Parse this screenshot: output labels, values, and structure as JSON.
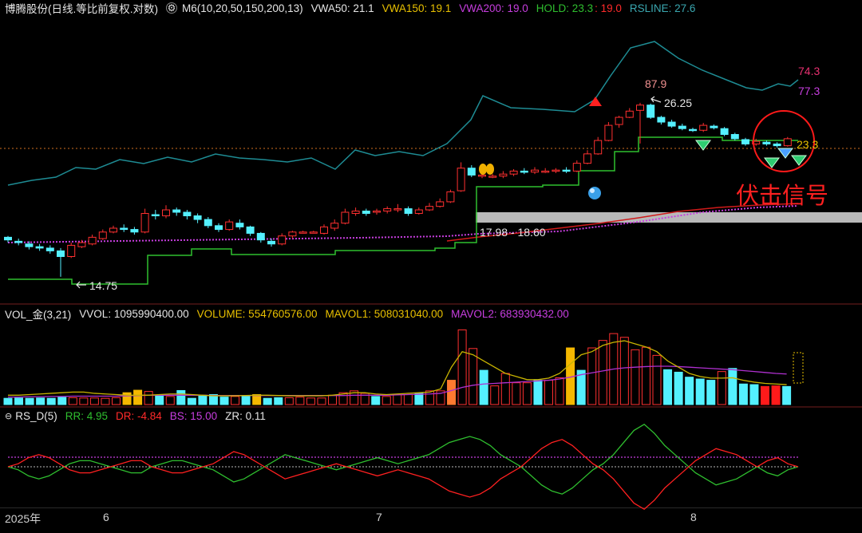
{
  "main_header": {
    "title": "博腾股份(日线.等比前复权.对数)",
    "m6": "M6(10,20,50,150,200,13)",
    "vwa50": "VWA50: 21.1",
    "vwa150": "VWA150: 19.1",
    "vwa200": "VWA200: 19.0",
    "hold": "HOLD: 23.3",
    "hold_red": ": 19.0",
    "rsline": "RSLINE: 27.6"
  },
  "vol_header": {
    "name": "VOL_金(3,21)",
    "vvol": "VVOL: 1095990400.00",
    "volume": "VOLUME: 554760576.00",
    "mavol1": "MAVOL1: 508031040.00",
    "mavol2": "MAVOL2: 683930432.00"
  },
  "rs_header": {
    "name": "RS_D(5)",
    "rr": "RR: 4.95",
    "dr": "DR: -4.84",
    "bs": "BS: 15.00",
    "zr": "ZR: 0.11"
  },
  "annotations": {
    "low_label": "14.75",
    "high_label": "26.25",
    "range_label": "17.98 - 18.60",
    "rs_peak": "87.9",
    "rs_right_1": "74.3",
    "rs_right_2": "77.3",
    "price_tag": "23.3",
    "signal_text": "伏击信号"
  },
  "x_axis": {
    "labels": [
      "2025年",
      "6",
      "7",
      "8"
    ]
  },
  "colors": {
    "up": "#ff3030",
    "down": "#54f0ff",
    "hold": "#2fbf2f",
    "rsline": "#1e8c94",
    "vwa": "#c83ee0",
    "ma_red": "#d01a1a",
    "mavol1": "#c8b400",
    "mavol2": "#b030d0",
    "highlight_bar": "#f5b800"
  },
  "chart_data": [
    {
      "type": "candlestick",
      "title": "博腾股份(日线.等比前复权.对数)",
      "candles": [
        [
          17.5,
          17.3,
          17.6,
          17.1
        ],
        [
          17.2,
          17.1,
          17.4,
          16.9
        ],
        [
          17.0,
          16.8,
          17.2,
          16.6
        ],
        [
          16.8,
          16.7,
          17.0,
          16.5
        ],
        [
          16.7,
          16.5,
          16.9,
          16.3
        ],
        [
          16.5,
          16.1,
          16.7,
          14.75
        ],
        [
          16.1,
          16.9,
          17.1,
          16.0
        ],
        [
          16.8,
          17.1,
          17.3,
          16.7
        ],
        [
          17.0,
          17.5,
          17.7,
          16.9
        ],
        [
          17.4,
          17.9,
          18.1,
          17.3
        ],
        [
          17.9,
          18.2,
          18.4,
          17.8
        ],
        [
          18.2,
          18.1,
          18.5,
          17.9
        ],
        [
          18.1,
          17.9,
          18.3,
          17.7
        ],
        [
          17.9,
          19.4,
          19.8,
          17.8
        ],
        [
          19.3,
          19.2,
          19.7,
          18.9
        ],
        [
          19.2,
          19.7,
          20.1,
          19.0
        ],
        [
          19.7,
          19.5,
          19.9,
          19.2
        ],
        [
          19.5,
          19.2,
          19.7,
          18.9
        ],
        [
          19.2,
          18.9,
          19.4,
          18.6
        ],
        [
          18.9,
          18.4,
          19.1,
          18.2
        ],
        [
          18.4,
          18.1,
          18.6,
          17.9
        ],
        [
          18.1,
          18.7,
          18.9,
          18.0
        ],
        [
          18.6,
          18.3,
          18.9,
          18.1
        ],
        [
          18.3,
          17.8,
          18.4,
          17.6
        ],
        [
          17.8,
          17.3,
          17.9,
          17.1
        ],
        [
          17.2,
          17.0,
          17.4,
          16.8
        ],
        [
          17.0,
          17.6,
          17.8,
          16.9
        ],
        [
          17.6,
          17.9,
          18.0,
          17.4
        ],
        [
          17.9,
          17.9,
          18.0,
          17.8
        ],
        [
          17.9,
          17.9,
          18.0,
          17.8
        ],
        [
          17.8,
          18.3,
          18.5,
          17.7
        ],
        [
          18.2,
          18.6,
          18.9,
          18.0
        ],
        [
          18.6,
          19.5,
          19.8,
          18.5
        ],
        [
          19.4,
          19.6,
          19.9,
          19.2
        ],
        [
          19.6,
          19.4,
          19.8,
          19.2
        ],
        [
          19.5,
          19.6,
          19.8,
          19.3
        ],
        [
          19.6,
          19.8,
          20.0,
          19.4
        ],
        [
          19.8,
          19.8,
          20.2,
          19.5
        ],
        [
          19.8,
          19.4,
          20.0,
          19.2
        ],
        [
          19.4,
          19.7,
          19.9,
          19.3
        ],
        [
          19.7,
          20.0,
          20.3,
          19.6
        ],
        [
          20.0,
          20.4,
          20.7,
          19.9
        ],
        [
          20.4,
          21.3,
          21.5,
          20.3
        ],
        [
          21.4,
          23.6,
          24.2,
          21.3
        ],
        [
          23.6,
          22.9,
          23.9,
          22.7
        ],
        [
          22.9,
          22.9,
          23.2,
          22.6
        ],
        [
          22.8,
          22.8,
          23.0,
          22.6
        ],
        [
          22.8,
          23.0,
          23.3,
          22.6
        ],
        [
          23.0,
          23.3,
          23.5,
          22.8
        ],
        [
          23.3,
          23.2,
          23.6,
          23.0
        ],
        [
          23.2,
          23.4,
          23.7,
          23.0
        ],
        [
          23.3,
          23.3,
          23.6,
          23.1
        ],
        [
          23.3,
          23.4,
          23.6,
          23.1
        ],
        [
          23.4,
          23.3,
          23.7,
          23.1
        ],
        [
          23.3,
          24.1,
          24.4,
          23.2
        ],
        [
          24.1,
          25.1,
          25.5,
          24.0
        ],
        [
          25.1,
          26.6,
          27.0,
          25.0
        ],
        [
          26.6,
          28.4,
          28.8,
          26.5
        ],
        [
          28.5,
          29.4,
          29.6,
          28.1
        ],
        [
          29.4,
          30.2,
          30.6,
          29.3
        ],
        [
          30.3,
          31.0,
          31.3,
          26.25
        ],
        [
          31.0,
          29.4,
          31.2,
          29.2
        ],
        [
          29.4,
          28.8,
          29.6,
          28.5
        ],
        [
          28.8,
          28.3,
          29.1,
          28.1
        ],
        [
          28.3,
          28.0,
          28.6,
          27.8
        ],
        [
          27.9,
          27.8,
          28.1,
          27.6
        ],
        [
          27.8,
          28.4,
          28.7,
          27.6
        ],
        [
          28.3,
          28.1,
          28.5,
          27.9
        ],
        [
          28.0,
          27.3,
          28.2,
          27.1
        ],
        [
          27.3,
          26.8,
          27.5,
          26.6
        ],
        [
          26.7,
          26.2,
          26.9,
          26.0
        ],
        [
          26.2,
          26.5,
          26.8,
          26.0
        ],
        [
          26.4,
          26.2,
          26.6,
          26.0
        ],
        [
          26.2,
          26.0,
          26.4,
          25.8
        ],
        [
          26.0,
          26.8,
          27.0,
          25.9
        ]
      ],
      "hold_label": "HOLD: 23.3",
      "range_label": "17.98 - 18.60"
    },
    {
      "type": "bar",
      "title": "VOL_金(3,21)",
      "values": [
        2.0,
        2.1,
        2.0,
        2.1,
        2.0,
        2.3,
        2.2,
        2.1,
        2.1,
        2.0,
        2.2,
        3.8,
        4.6,
        4.2,
        3.0,
        2.6,
        4.5,
        2.0,
        3.0,
        3.2,
        2.4,
        2.6,
        2.8,
        3.2,
        2.0,
        2.2,
        2.2,
        2.4,
        2.1,
        2.1,
        3.0,
        3.8,
        4.4,
        3.6,
        2.6,
        2.6,
        3.2,
        3.2,
        3.6,
        4.4,
        4.4,
        7.8,
        24.0,
        18.0,
        11.0,
        6.0,
        10.0,
        7.0,
        7.0,
        7.8,
        7.8,
        8.6,
        18.2,
        11.0,
        18.2,
        20.6,
        22.8,
        21.6,
        17.6,
        18.4,
        15.8,
        11.2,
        10.4,
        8.8,
        8.2,
        7.8,
        10.6,
        11.6,
        6.6,
        6.4,
        5.8,
        6.0,
        5.8
      ],
      "mavol1": [
        3.0,
        3.0,
        3.2,
        3.4,
        3.6,
        3.8,
        4.0,
        4.0,
        3.6,
        3.4,
        3.2,
        3.0,
        3.0,
        3.0,
        3.2,
        3.4,
        3.4,
        3.2,
        3.0,
        2.8,
        2.8,
        2.8,
        2.9,
        3.0,
        3.0,
        2.9,
        2.8,
        2.8,
        2.8,
        2.8,
        3.0,
        3.4,
        3.8,
        3.8,
        3.4,
        3.2,
        3.4,
        3.6,
        3.8,
        4.0,
        5.0,
        12.0,
        17.0,
        16.0,
        14.0,
        12.0,
        10.0,
        9.0,
        8.0,
        8.0,
        8.5,
        10.0,
        13.0,
        16.0,
        17.0,
        19.0,
        20.0,
        20.5,
        19.5,
        18.5,
        17.0,
        14.0,
        12.0,
        10.0,
        9.0,
        8.5,
        8.5,
        8.6,
        7.8,
        7.2,
        6.8,
        6.6,
        6.4
      ],
      "mavol2": [
        2.4,
        2.4,
        2.5,
        2.5,
        2.6,
        2.6,
        2.7,
        2.7,
        2.7,
        2.7,
        2.7,
        2.8,
        2.9,
        3.0,
        3.0,
        3.0,
        3.0,
        3.0,
        3.0,
        2.9,
        2.9,
        2.9,
        2.9,
        2.9,
        2.9,
        2.9,
        2.9,
        2.9,
        2.9,
        2.9,
        2.9,
        2.9,
        3.0,
        3.0,
        3.0,
        3.0,
        3.1,
        3.2,
        3.3,
        3.4,
        3.6,
        4.5,
        5.5,
        6.2,
        6.6,
        6.8,
        7.0,
        7.2,
        7.4,
        7.6,
        7.8,
        8.2,
        8.8,
        9.6,
        10.2,
        10.8,
        11.4,
        11.8,
        12.0,
        12.2,
        12.3,
        12.3,
        12.2,
        12.0,
        11.8,
        11.6,
        11.4,
        11.2,
        10.9,
        10.6,
        10.3,
        10.0,
        9.8
      ],
      "highlight_indices": [
        11,
        12,
        23,
        41,
        52
      ],
      "red_fill_indices": [
        70,
        71
      ]
    },
    {
      "type": "line",
      "title": "RS_D(5)",
      "series": [
        {
          "name": "RR",
          "values": [
            0,
            -1,
            -3,
            -4,
            -3,
            -1,
            1,
            2,
            2,
            1,
            0,
            -1,
            -2,
            -2,
            0,
            1,
            2,
            2,
            1,
            0,
            -1,
            -3,
            -5,
            -4,
            -2,
            0,
            2,
            4,
            3,
            2,
            1,
            0,
            -1,
            0,
            1,
            2,
            3,
            2,
            1,
            2,
            3,
            4,
            6,
            8,
            9,
            10,
            9,
            7,
            4,
            2,
            0,
            -3,
            -6,
            -8,
            -9,
            -7,
            -4,
            -1,
            1,
            4,
            8,
            12,
            14,
            11,
            7,
            4,
            1,
            -2,
            -4,
            -6,
            -5,
            -4,
            -2,
            0,
            -2,
            -3,
            -1,
            0
          ]
        },
        {
          "name": "DR",
          "values": [
            0,
            1,
            3,
            4,
            3,
            1,
            -1,
            -2,
            -2,
            -1,
            0,
            1,
            2,
            2,
            0,
            -1,
            -2,
            -2,
            -1,
            0,
            1,
            3,
            5,
            4,
            2,
            0,
            -2,
            -4,
            -3,
            -2,
            -1,
            0,
            1,
            0,
            -1,
            -2,
            -3,
            -2,
            -1,
            -2,
            -3,
            -4,
            -6,
            -8,
            -9,
            -10,
            -9,
            -7,
            -4,
            -2,
            0,
            3,
            6,
            8,
            9,
            7,
            4,
            1,
            -1,
            -4,
            -8,
            -12,
            -14,
            -11,
            -7,
            -4,
            -1,
            2,
            4,
            6,
            5,
            4,
            2,
            0,
            2,
            3,
            1,
            0
          ]
        }
      ],
      "bs": 15.0,
      "zr": 0.11
    }
  ]
}
